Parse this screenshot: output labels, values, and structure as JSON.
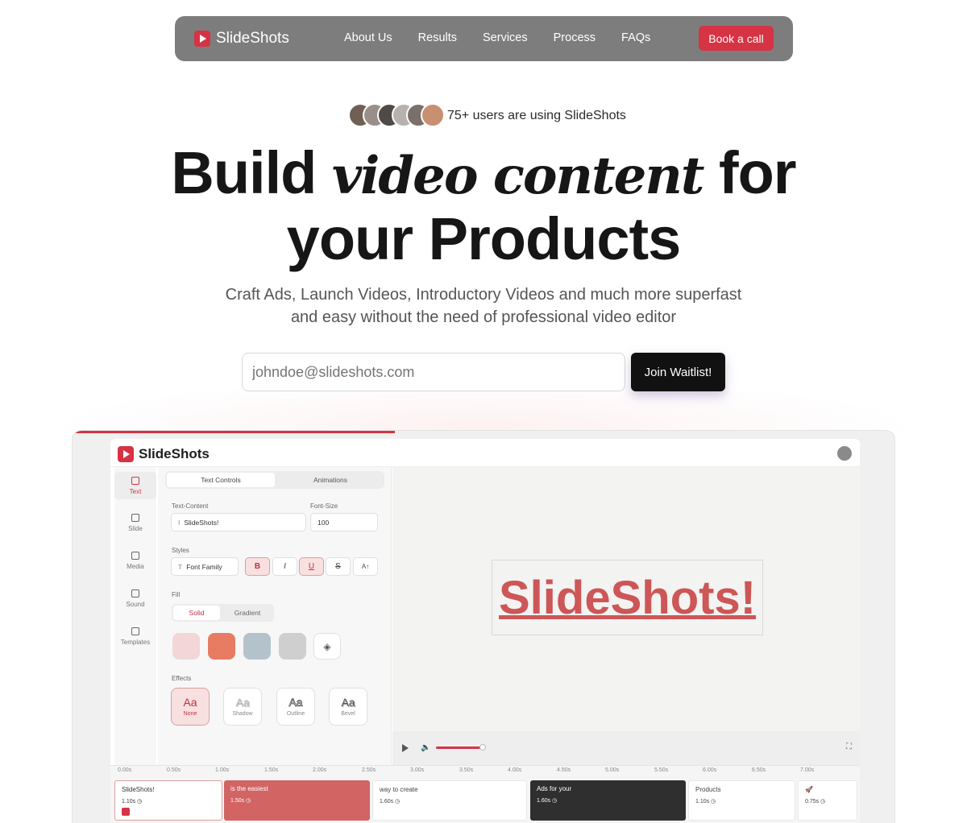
{
  "nav": {
    "brand": "SlideShots",
    "links": [
      "About Us",
      "Results",
      "Services",
      "Process",
      "FAQs"
    ],
    "cta": "Book a call"
  },
  "hero": {
    "users_text": "75+ users are using SlideShots",
    "headline_pre": "Build ",
    "headline_italic": "video content",
    "headline_mid": " for",
    "headline_line2": "your Products",
    "sub_line1": "Craft Ads, Launch Videos, Introductory Videos and much more superfast",
    "sub_line2": "and easy without the need of professional video editor",
    "email_placeholder": "johndoe@slideshots.com",
    "join_label": "Join Waitlist!"
  },
  "colors": {
    "accent": "#d63344",
    "nav_bg": "#7d7d7d",
    "avatar_colors": [
      "#6f5f55",
      "#9a8f88",
      "#4f4a48",
      "#b7b2ae",
      "#7b6f6a",
      "#c89070"
    ]
  },
  "app": {
    "brand": "SlideShots",
    "sidebar": [
      {
        "label": "Text",
        "icon": "text-icon"
      },
      {
        "label": "Slide",
        "icon": "slide-icon"
      },
      {
        "label": "Media",
        "icon": "media-icon"
      },
      {
        "label": "Sound",
        "icon": "music-icon"
      },
      {
        "label": "Templates",
        "icon": "templates-icon"
      }
    ],
    "tabs": {
      "text_controls": "Text Controls",
      "animations": "Animations"
    },
    "text_content_label": "Text-Content",
    "text_content_value": "SlideShots!",
    "font_size_label": "Font-Size",
    "font_size_value": "100",
    "styles_label": "Styles",
    "font_family": "Font Family",
    "style_buttons": [
      "B",
      "I",
      "U",
      "S",
      "A↑"
    ],
    "fill_label": "Fill",
    "fill_tabs": [
      "Solid",
      "Gradient"
    ],
    "swatches": [
      "#f2d6d8",
      "#e77c63",
      "#b4c2cc",
      "#cfcfcf"
    ],
    "effects_label": "Effects",
    "effects": [
      "None",
      "Shadow",
      "Outline",
      "Bevel"
    ],
    "effect_glyph": "Aa",
    "canvas_text": "SlideShots!",
    "ruler": [
      "0.00s",
      "0.50s",
      "1.00s",
      "1.50s",
      "2.00s",
      "2.50s",
      "3.00s",
      "3.50s",
      "4.00s",
      "4.50s",
      "5.00s",
      "5.50s",
      "6.00s",
      "6.50s",
      "7.00s"
    ],
    "clips": [
      {
        "title": "SlideShots!",
        "dur": "1.10s ◷"
      },
      {
        "title": "is the easiest",
        "dur": "1.50s ◷"
      },
      {
        "title": "way to create",
        "dur": "1.60s ◷"
      },
      {
        "title": "Ads for your",
        "dur": "1.60s ◷"
      },
      {
        "title": "Products",
        "dur": "1.10s ◷"
      },
      {
        "title": "🚀",
        "dur": "0.75s ◷"
      }
    ]
  }
}
